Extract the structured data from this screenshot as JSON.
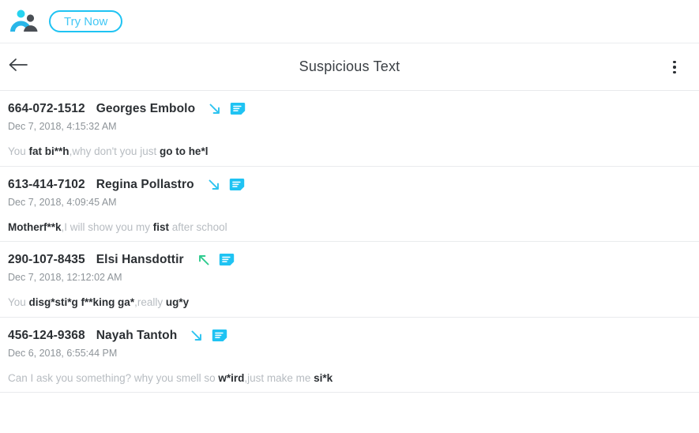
{
  "promo": {
    "logo_icon": "two-people-icon",
    "try_label": "Try Now"
  },
  "header": {
    "back_icon": "back-arrow-icon",
    "title": "Suspicious Text",
    "menu_icon": "more-vertical-icon"
  },
  "colors": {
    "accent": "#1fc3f3",
    "incoming_arrow": "#2dc3f0",
    "outgoing_arrow": "#2ecb8e",
    "bubble": "#1fc3f3",
    "text_dark": "#2b2f33",
    "text_muted": "#b7bcc1",
    "timestamp": "#8e9499",
    "divider": "#e9ebed"
  },
  "messages": [
    {
      "phone": "664-072-1512",
      "name": "Georges Embolo",
      "direction_icon": "arrow-down-right-icon",
      "direction": "incoming",
      "bubble_icon": "message-bubble-icon",
      "timestamp": "Dec 7, 2018, 4:15:32 AM",
      "segments": [
        {
          "text": "You ",
          "flagged": false
        },
        {
          "text": "fat bi**h",
          "flagged": true
        },
        {
          "text": ",why don't you just ",
          "flagged": false
        },
        {
          "text": "go to he*l",
          "flagged": true
        }
      ]
    },
    {
      "phone": "613-414-7102",
      "name": "Regina Pollastro",
      "direction_icon": "arrow-down-right-icon",
      "direction": "incoming",
      "bubble_icon": "message-bubble-icon",
      "timestamp": "Dec 7, 2018, 4:09:45 AM",
      "segments": [
        {
          "text": "Motherf**k",
          "flagged": true
        },
        {
          "text": ",I will show you my ",
          "flagged": false
        },
        {
          "text": "fist",
          "flagged": true
        },
        {
          "text": " after school",
          "flagged": false
        }
      ]
    },
    {
      "phone": "290-107-8435",
      "name": "Elsi Hansdottir",
      "direction_icon": "arrow-up-left-icon",
      "direction": "outgoing",
      "bubble_icon": "message-bubble-icon",
      "timestamp": "Dec 7, 2018, 12:12:02 AM",
      "segments": [
        {
          "text": "You ",
          "flagged": false
        },
        {
          "text": "disg*sti*g f**king ga*",
          "flagged": true
        },
        {
          "text": ",really ",
          "flagged": false
        },
        {
          "text": "ug*y",
          "flagged": true
        }
      ]
    },
    {
      "phone": "456-124-9368",
      "name": "Nayah Tantoh",
      "direction_icon": "arrow-down-right-icon",
      "direction": "incoming",
      "bubble_icon": "message-bubble-icon",
      "timestamp": "Dec 6, 2018, 6:55:44 PM",
      "segments": [
        {
          "text": "Can I ask you something? why you smell so ",
          "flagged": false
        },
        {
          "text": "w*ird",
          "flagged": true
        },
        {
          "text": ",just make me ",
          "flagged": false
        },
        {
          "text": "si*k",
          "flagged": true
        }
      ]
    }
  ]
}
